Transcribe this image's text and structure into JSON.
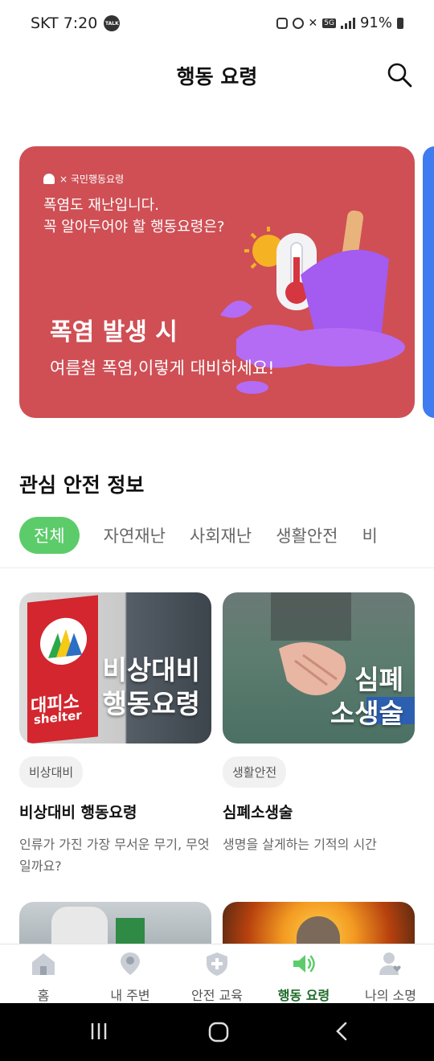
{
  "status_bar": {
    "carrier_time": "SKT 7:20",
    "talk_badge": "TALK",
    "network": "5G",
    "battery": "91%"
  },
  "header": {
    "title": "행동 요령"
  },
  "banner": {
    "brand": "× 국민행동요령",
    "headline_line1": "폭염도 재난입니다.",
    "headline_line2": "꼭 알아두어야 할 행동요령은?",
    "main": "폭염 발생 시",
    "sub": "여름철 폭염,이렇게 대비하세요!"
  },
  "section": {
    "title": "관심 안전 정보"
  },
  "chips": [
    "전체",
    "자연재난",
    "사회재난",
    "생활안전",
    "비"
  ],
  "cards": [
    {
      "thumb_line1": "비상대비",
      "thumb_line2": "행동요령",
      "sign_line1": "대피소",
      "sign_line2": "shelter",
      "badge": "비상대비",
      "title": "비상대비 행동요령",
      "desc": "인류가 가진 가장 무서운 무기, 무엇일까요?"
    },
    {
      "thumb_line1": "심폐",
      "thumb_line2": "소생술",
      "badge": "생활안전",
      "title": "심폐소생술",
      "desc": "생명을 살게하는 기적의 시간"
    }
  ],
  "bottom_nav": [
    {
      "label": "홈",
      "icon": "home-icon"
    },
    {
      "label": "내 주변",
      "icon": "location-pin-icon"
    },
    {
      "label": "안전 교육",
      "icon": "shield-cross-icon"
    },
    {
      "label": "행동 요령",
      "icon": "speaker-icon"
    },
    {
      "label": "나의 소명",
      "icon": "person-heart-icon"
    }
  ],
  "colors": {
    "accent": "#5ccc6a",
    "banner": "#cf4f55",
    "nav_active": "#1f6b2a"
  }
}
